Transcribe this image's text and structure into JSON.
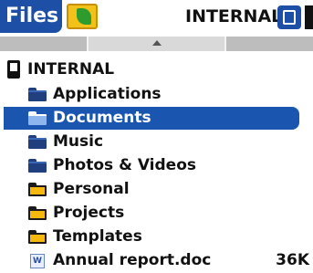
{
  "header": {
    "app_title": "Files",
    "app_icon": "folder-app-icon",
    "location": "INTERNAL",
    "card_icon": "memory-card-icon"
  },
  "scrollbar": {
    "up_icon": "triangle-up-icon"
  },
  "tree": {
    "root": {
      "label": "INTERNAL",
      "icon": "device-icon"
    },
    "items": [
      {
        "label": "Applications",
        "icon": "folder-icon"
      },
      {
        "label": "Documents",
        "icon": "folder-icon",
        "selected": true
      },
      {
        "label": "Music",
        "icon": "folder-icon"
      },
      {
        "label": "Photos & Videos",
        "icon": "folder-icon"
      },
      {
        "label": "Personal",
        "icon": "folder-icon"
      },
      {
        "label": "Projects",
        "icon": "folder-icon"
      },
      {
        "label": "Templates",
        "icon": "folder-icon"
      }
    ],
    "file": {
      "label": "Annual report.doc",
      "size": "36K",
      "icon": "word-document-icon"
    }
  },
  "colors": {
    "accent": "#1d4fa6",
    "selection": "#1a55b0",
    "folder_blue": "#1f3f7f",
    "folder_yellow": "#f6b80e"
  }
}
